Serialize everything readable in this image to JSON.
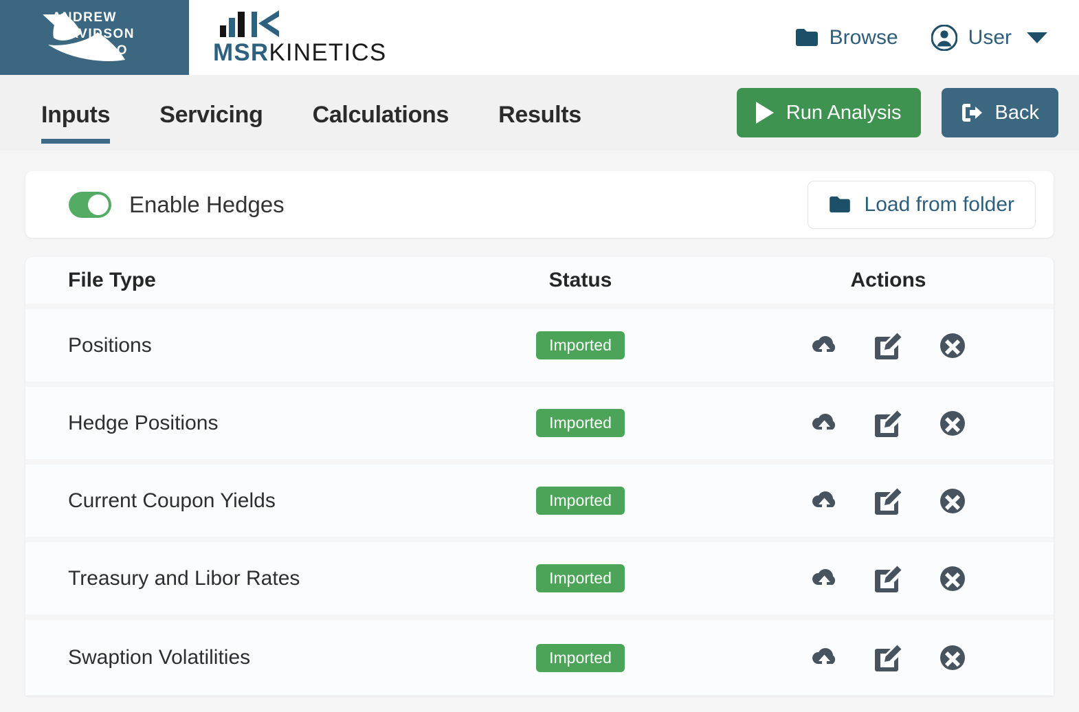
{
  "header": {
    "brand_logo_alt": "Andrew Davidson & Co",
    "brand_lines": [
      "ANDREW",
      "DAVIDSON",
      "& CO"
    ],
    "product_name_prefix": "MSR",
    "product_name_suffix": "KINETICS",
    "browse_label": "Browse",
    "user_label": "User"
  },
  "nav": {
    "tabs": [
      {
        "label": "Inputs",
        "active": true
      },
      {
        "label": "Servicing",
        "active": false
      },
      {
        "label": "Calculations",
        "active": false
      },
      {
        "label": "Results",
        "active": false
      }
    ],
    "run_label": "Run Analysis",
    "back_label": "Back"
  },
  "hedges": {
    "toggle_label": "Enable Hedges",
    "toggle_on": true,
    "load_label": "Load from folder"
  },
  "table": {
    "columns": [
      "File Type",
      "Status",
      "Actions"
    ],
    "rows": [
      {
        "type": "Positions",
        "status": "Imported"
      },
      {
        "type": "Hedge Positions",
        "status": "Imported"
      },
      {
        "type": "Current Coupon Yields",
        "status": "Imported"
      },
      {
        "type": "Treasury and Libor Rates",
        "status": "Imported"
      },
      {
        "type": "Swaption Volatilities",
        "status": "Imported"
      }
    ],
    "row_actions": [
      "upload-cloud-icon",
      "edit-icon",
      "remove-icon"
    ]
  },
  "colors": {
    "brand_blue": "#3b6781",
    "accent_green": "#3f9351",
    "badge_green": "#4ba457",
    "toggle_green": "#54ac64",
    "page_bg": "#f5f5f6",
    "nav_bg": "#f1f1f2",
    "icon_slate": "#47545f"
  }
}
